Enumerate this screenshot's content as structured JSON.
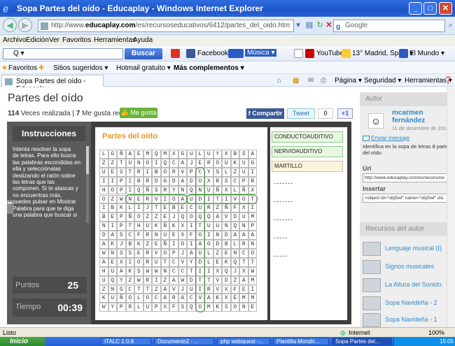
{
  "window": {
    "title": "Sopa Partes del oído - Educaplay - Windows Internet Explorer",
    "controls": [
      "_",
      "□",
      "✕"
    ]
  },
  "address": {
    "url_prefix": "http://www.",
    "url_domain": "educaplay.com",
    "url_rest": "/es/recursoseducativos/6412/partes_del_oido.htm",
    "search_placeholder": "Google"
  },
  "menu": [
    "Archivo",
    "Edición",
    "Ver",
    "Favoritos",
    "Herramientas",
    "Ayuda"
  ],
  "toolbar": {
    "search_placeholder": "Q ▾",
    "buscar": "Buscar",
    "facebook": "Facebook ▾",
    "musica": "Música ▾",
    "youtube": "YouTube",
    "weather": "13° Madrid, Spain ▾",
    "elmundo": "El Mundo ▾",
    "opciones": "Opciones ▾"
  },
  "favorites": {
    "label": "Favoritos",
    "items": [
      "Sitios sugeridos ▾",
      "Hotmail gratuito ▾",
      "Más complementos ▾"
    ]
  },
  "tabs": {
    "active": "Sopa Partes del oído - Educaplay",
    "tools": [
      "Página ▾",
      "Seguridad ▾",
      "Herramientas ▾"
    ]
  },
  "page": {
    "title": "Partes del oído",
    "views_num": "114",
    "views_label": "Veces realizada",
    "likes_num": "7",
    "likes_label": "Me gusta recibidos",
    "like_btn": "Me gusta",
    "share_btn": "Compartir",
    "tweet_btn": "Tweet",
    "tweet_count": "0",
    "plus_btn": "+1"
  },
  "game": {
    "instructions_title": "Instrucciones",
    "instructions": "Intenta resolver la sopa\nde letras. Para ello busca\nlas palabras escondidas en\nella y selecciónalas\ndeslizando el ratón sobre\nlas letras que las\ncomponen. Si te atascas y\nno encuentras más,\npuedes pulsar en Mostrar\nPalabra para que te diga\nuna palabra que buscar si",
    "points_label": "Puntos",
    "points": "25",
    "time_label": "Tiempo",
    "time": "00:39",
    "board_title": "Partes del oído",
    "grid": [
      "LGÑAEMQMXGULUYXBSA",
      "ZZTUNOIQCAJEROUKUG",
      "UESTRIBORVPCYSLZUI",
      "IIPIBRDGDADOXRSCPR",
      "HOPIQÑSRYNQNUÑXLÑX",
      "OZWNERVIOAUDITIVOT",
      "IBKLIJTEBECURZÑFXI",
      "BEPÑOZZEJQOQQAVDUM",
      "NIPTHUKÑKXITUUNQNP",
      "DASCFRNUEXFOINDAAA",
      "AKJBKZEÑIOIAODBLRN",
      "WNSSERVOPJAULZENCO",
      "AEXIORUTCVYDLEKQTT",
      "HUAKSWWNCCTIIXQJXW",
      "UQYZWRIZAWDTTVDZAM",
      "ZNGCTTZAVJUIRVXFEI",
      "KUÑOLOCARACVAKXEMM",
      "WYPRLUPXFSQOMKSONE"
    ],
    "words": [
      "CONDUCTOAUDITIVO",
      "NERVIOAUDITIVO",
      "MARTILLO",
      "-------",
      "-------",
      "-------",
      "-----",
      "-----"
    ]
  },
  "author": {
    "header": "Autor",
    "name": "mcarmen fernández",
    "date": "11 de diciembre de 2010",
    "send_msg": "Enviar mensaje",
    "desc": "Identifica en la sopa de letras 8 partes del oído.",
    "url_label": "Url",
    "url_value": "http://www.educaplay.com/es/recursose",
    "insert_label": "Insertar",
    "insert_value": "<object id=\"objSwf\" name=\"objSwf\" cla"
  },
  "resources": {
    "header": "Recursos del autor",
    "items": [
      "Lenguaje musical (I)",
      "Signos musicales",
      "La Altura del Sonido.",
      "Sopa Navideña - 2",
      "Sopa Navideña - 1"
    ]
  },
  "status": {
    "text": "Listo",
    "zone": "Internet",
    "zoom": "100%"
  },
  "taskbar": {
    "start": "Inicio",
    "tasks": [
      "ITALC 1.0.8",
      "Documento2 - ...",
      "php webquest -...",
      "Plantilla Mondri...",
      "Sopa Partes del..."
    ],
    "clock": "15:05"
  }
}
